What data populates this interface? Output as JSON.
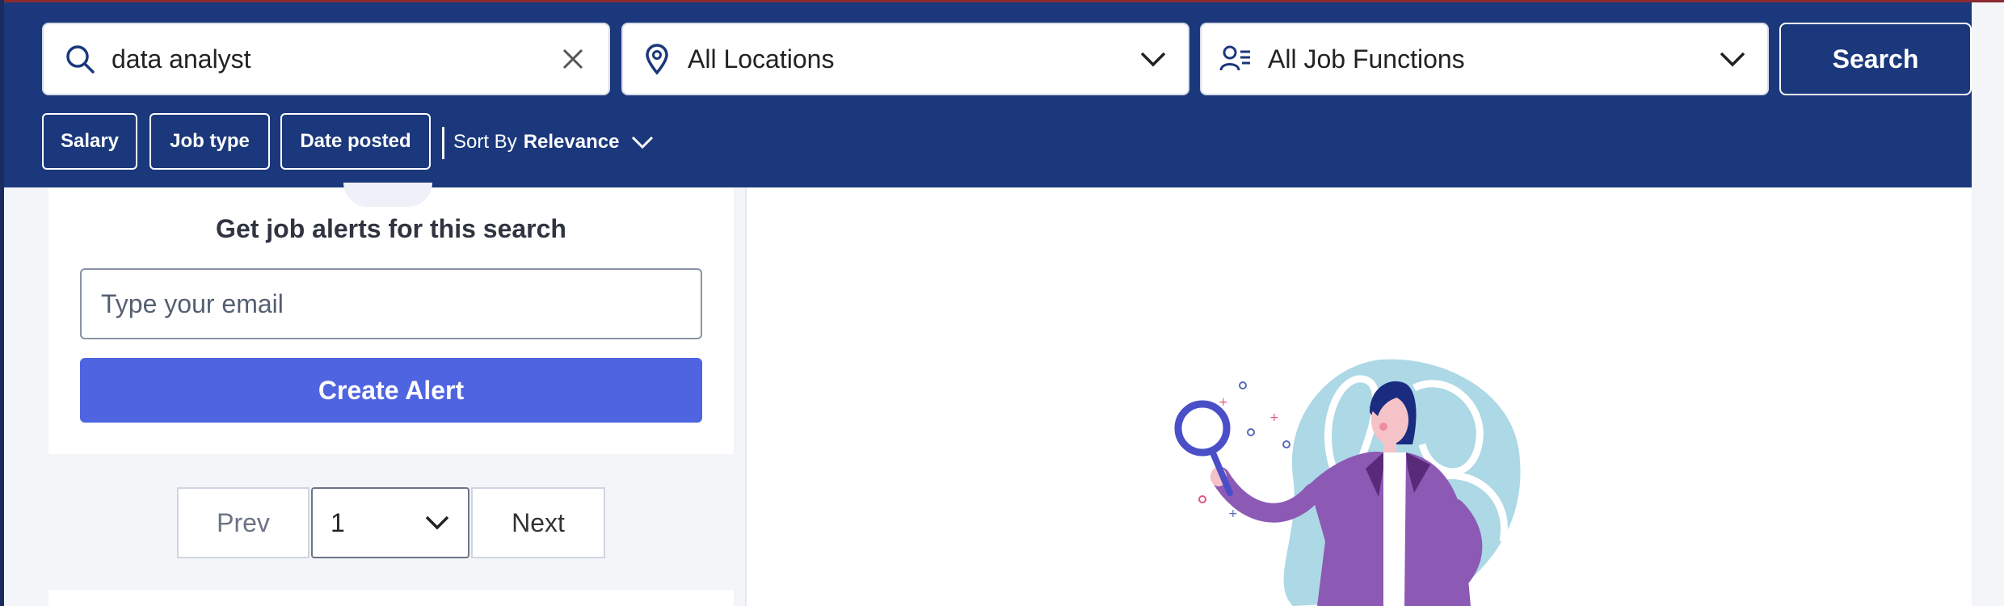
{
  "search": {
    "keyword_value": "data analyst",
    "location_value": "All Locations",
    "job_function_value": "All Job Functions",
    "search_label": "Search"
  },
  "filters": {
    "salary_label": "Salary",
    "job_type_label": "Job type",
    "date_posted_label": "Date posted",
    "sort_prefix": "Sort By",
    "sort_value": "Relevance"
  },
  "alerts": {
    "title": "Get job alerts for this search",
    "email_placeholder": "Type your email",
    "create_label": "Create Alert"
  },
  "pagination": {
    "prev_label": "Prev",
    "current_page": "1",
    "next_label": "Next"
  },
  "colors": {
    "header_bg": "#1b387c",
    "accent_button": "#4f64e0",
    "page_bg": "#f3f5f9"
  }
}
